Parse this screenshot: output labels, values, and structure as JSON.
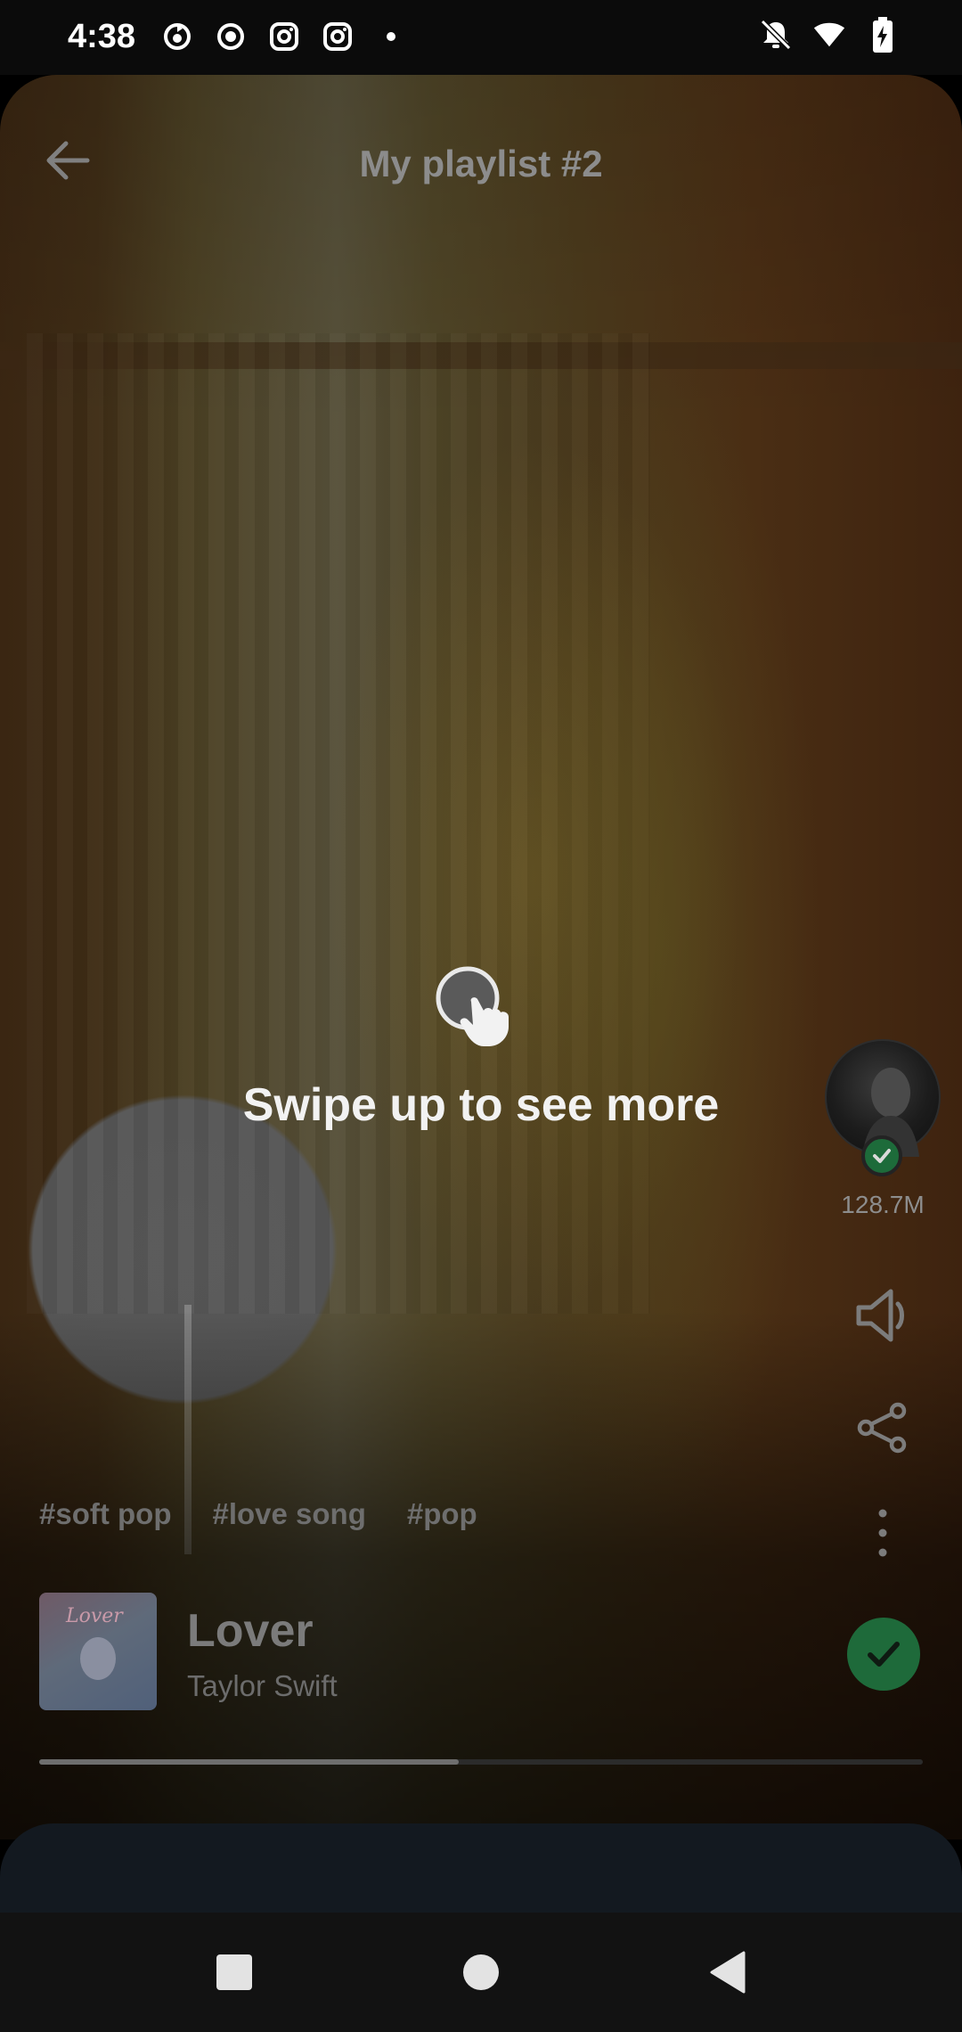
{
  "status_bar": {
    "time": "4:38",
    "left_icons": [
      "sync-icon",
      "record-icon",
      "instagram-icon",
      "instagram-icon",
      "dot-icon"
    ],
    "right_icons": [
      "bell-off-icon",
      "wifi-icon",
      "battery-charging-icon"
    ]
  },
  "header": {
    "title": "My playlist #2",
    "back_icon": "arrow-left-icon"
  },
  "swipe_hint": {
    "icon": "tap-hand-icon",
    "text": "Swipe up to see more"
  },
  "side_rail": {
    "follower_count": "128.7M",
    "verified_icon": "check-icon",
    "sound_icon": "speaker-icon",
    "share_icon": "share-icon",
    "more_icon": "more-vertical-icon"
  },
  "tags": [
    "#soft pop",
    "#love song",
    "#pop"
  ],
  "track": {
    "title": "Lover",
    "artist": "Taylor Swift",
    "saved_icon": "check-icon",
    "album_script": "Lover"
  },
  "progress": {
    "fraction": 0.475
  },
  "nav_bar": {
    "recents_icon": "square-icon",
    "home_icon": "circle-icon",
    "back_icon": "triangle-back-icon"
  },
  "colors": {
    "accent_green": "#1e6a3a",
    "muted_text": "#7b7b7b"
  }
}
